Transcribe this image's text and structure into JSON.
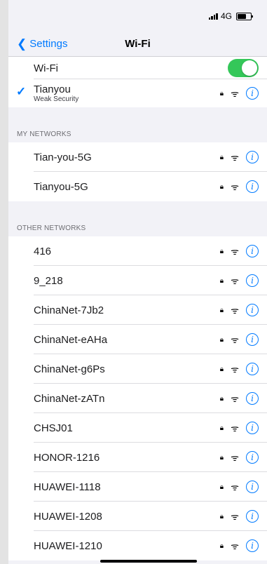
{
  "status_bar": {
    "network": "4G"
  },
  "nav": {
    "back_label": "Settings",
    "title": "Wi-Fi"
  },
  "wifi_toggle": {
    "label": "Wi-Fi",
    "enabled": true
  },
  "current_network": {
    "name": "Tianyou",
    "subtitle": "Weak Security",
    "connected": true
  },
  "sections": {
    "my_networks": {
      "header": "MY NETWORKS",
      "networks": [
        {
          "name": "Tian-you-5G",
          "locked": true
        },
        {
          "name": "Tianyou-5G",
          "locked": true
        }
      ]
    },
    "other_networks": {
      "header": "OTHER NETWORKS",
      "networks": [
        {
          "name": "416",
          "locked": true
        },
        {
          "name": "9_218",
          "locked": true
        },
        {
          "name": "ChinaNet-7Jb2",
          "locked": true
        },
        {
          "name": "ChinaNet-eAHa",
          "locked": true
        },
        {
          "name": "ChinaNet-g6Ps",
          "locked": true
        },
        {
          "name": "ChinaNet-zATn",
          "locked": true
        },
        {
          "name": "CHSJ01",
          "locked": true
        },
        {
          "name": "HONOR-1216",
          "locked": true
        },
        {
          "name": "HUAWEI-1118",
          "locked": true
        },
        {
          "name": "HUAWEI-1208",
          "locked": true
        },
        {
          "name": "HUAWEI-1210",
          "locked": true
        }
      ]
    }
  },
  "icons": {
    "lock": "lock-icon",
    "wifi": "wifi-signal-icon",
    "info": "info-icon",
    "check": "checkmark-icon",
    "back": "chevron-left-icon"
  },
  "colors": {
    "accent": "#007aff",
    "toggle_on": "#34c759",
    "background": "#f2f2f7"
  }
}
